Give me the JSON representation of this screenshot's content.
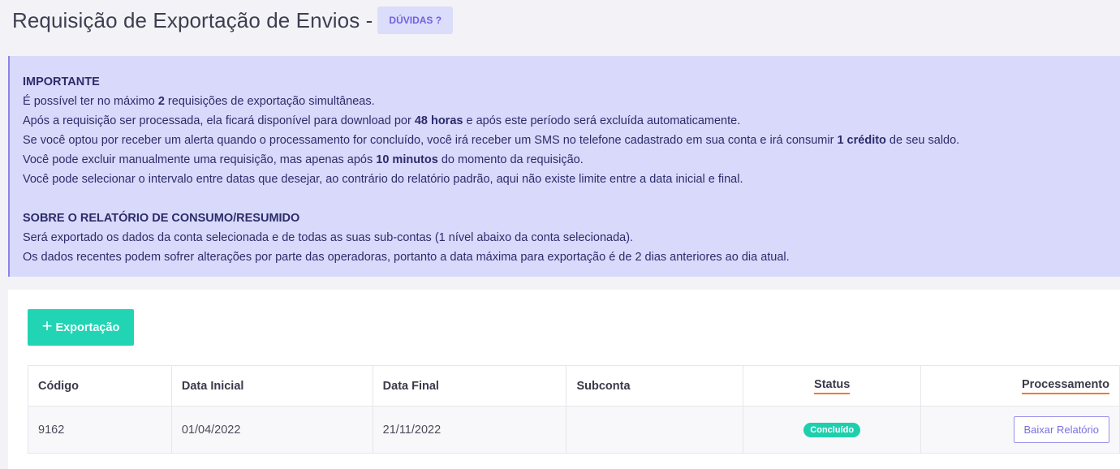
{
  "header": {
    "title": "Requisição de Exportação de Envios -",
    "help_label": "DÚVIDAS ?"
  },
  "notice": {
    "important_heading": "IMPORTANTE",
    "line1_pre": "É possível ter no máximo ",
    "line1_bold": "2",
    "line1_post": " requisições de exportação simultâneas.",
    "line2_pre": "Após a requisição ser processada, ela ficará disponível para download por ",
    "line2_bold": "48 horas",
    "line2_post": " e após este período será excluída automaticamente.",
    "line3_pre": "Se você optou por receber um alerta quando o processamento for concluído, você irá receber um SMS no telefone cadastrado em sua conta e irá consumir ",
    "line3_bold": "1 crédito",
    "line3_post": " de seu saldo.",
    "line4_pre": "Você pode excluir manualmente uma requisição, mas apenas após ",
    "line4_bold": "10 minutos",
    "line4_post": " do momento da requisição.",
    "line5": "Você pode selecionar o intervalo entre datas que desejar, ao contrário do relatório padrão, aqui não existe limite entre a data inicial e final.",
    "consumption_heading": "SOBRE O RELATÓRIO DE CONSUMO/RESUMIDO",
    "line6": "Será exportado os dados da conta selecionada e de todas as suas sub-contas (1 nível abaixo da conta selecionada).",
    "line7": "Os dados recentes podem sofrer alterações por parte das operadoras, portanto a data máxima para exportação é de 2 dias anteriores ao dia atual."
  },
  "toolbar": {
    "export_label": "Exportação",
    "plus_glyph": "+"
  },
  "table": {
    "columns": [
      "Código",
      "Data Inicial",
      "Data Final",
      "Subconta",
      "Status",
      "Processamento"
    ],
    "rows": [
      {
        "code": "9162",
        "start_date": "01/04/2022",
        "end_date": "21/11/2022",
        "subaccount": "",
        "status": "Concluído",
        "action_label": "Baixar Relatório"
      }
    ]
  },
  "colors": {
    "accent": "#21d4b3",
    "notice_bg": "#d9d9fb",
    "help_text": "#6c63e0",
    "underline": "#f47a2f"
  }
}
